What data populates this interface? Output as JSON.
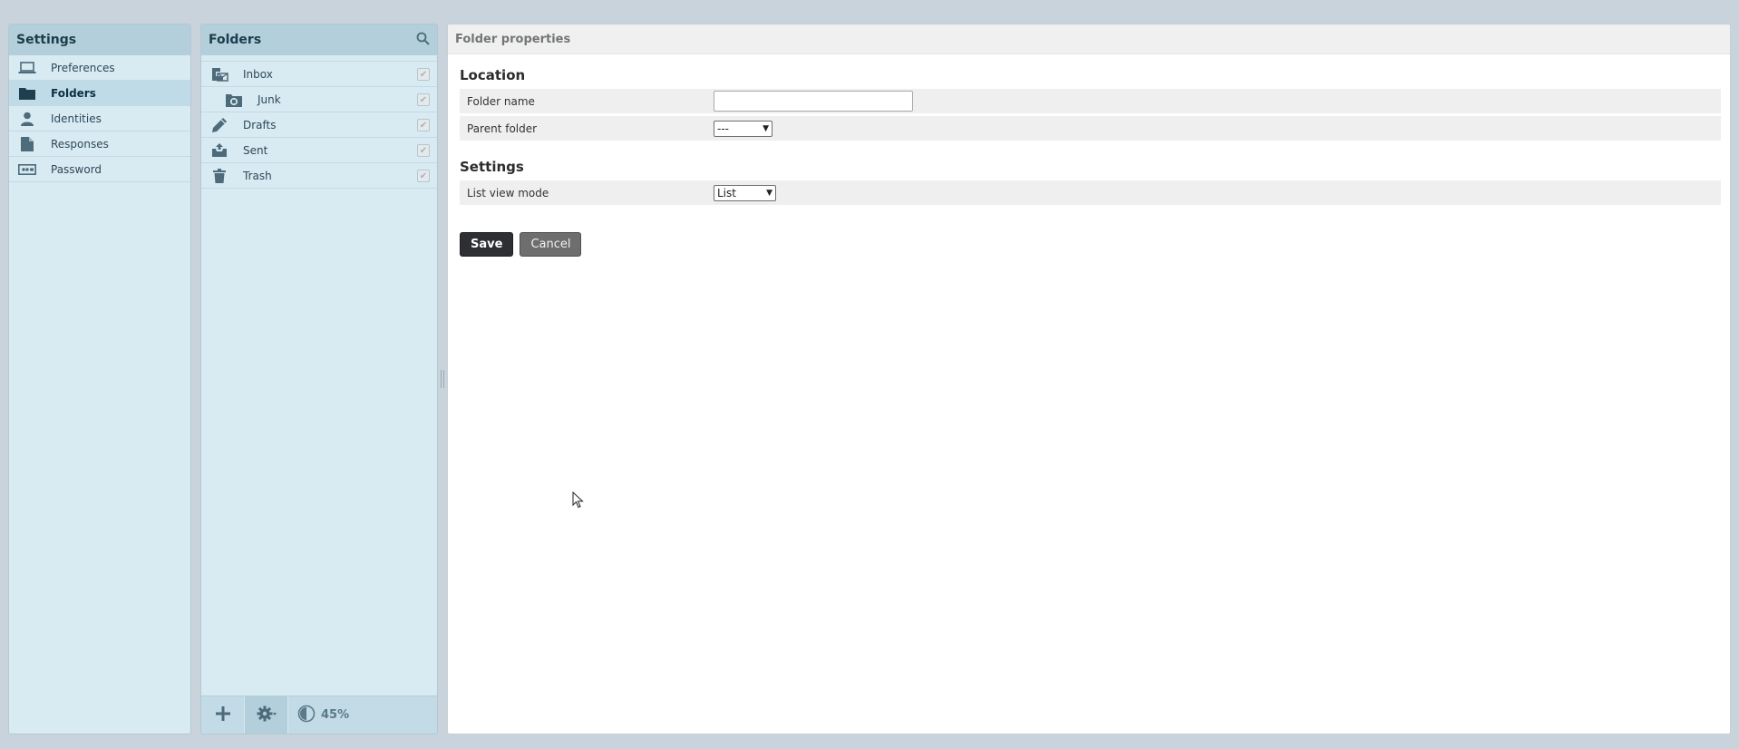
{
  "settings": {
    "title": "Settings",
    "items": [
      {
        "label": "Preferences",
        "icon": "laptop-icon"
      },
      {
        "label": "Folders",
        "icon": "folder-icon",
        "selected": true
      },
      {
        "label": "Identities",
        "icon": "person-icon"
      },
      {
        "label": "Responses",
        "icon": "document-icon"
      },
      {
        "label": "Password",
        "icon": "password-icon"
      }
    ]
  },
  "folders": {
    "title": "Folders",
    "items": [
      {
        "label": "Inbox",
        "icon": "inbox-icon"
      },
      {
        "label": "Junk",
        "icon": "junk-icon",
        "sub": true
      },
      {
        "label": "Drafts",
        "icon": "pencil-icon"
      },
      {
        "label": "Sent",
        "icon": "sent-icon"
      },
      {
        "label": "Trash",
        "icon": "trash-icon"
      }
    ],
    "quota": "45%",
    "quota_value": 0.45
  },
  "properties": {
    "title": "Folder properties",
    "location_title": "Location",
    "folder_name_label": "Folder name",
    "folder_name_value": "",
    "parent_folder_label": "Parent folder",
    "parent_folder_value": "---",
    "settings_title": "Settings",
    "list_view_mode_label": "List view mode",
    "list_view_mode_value": "List",
    "save_label": "Save",
    "cancel_label": "Cancel"
  },
  "colors": {
    "background": "#c9d3dc",
    "panel": "#d8eaf2",
    "header": "#b2cfdb",
    "save_button": "#2d2f33"
  }
}
